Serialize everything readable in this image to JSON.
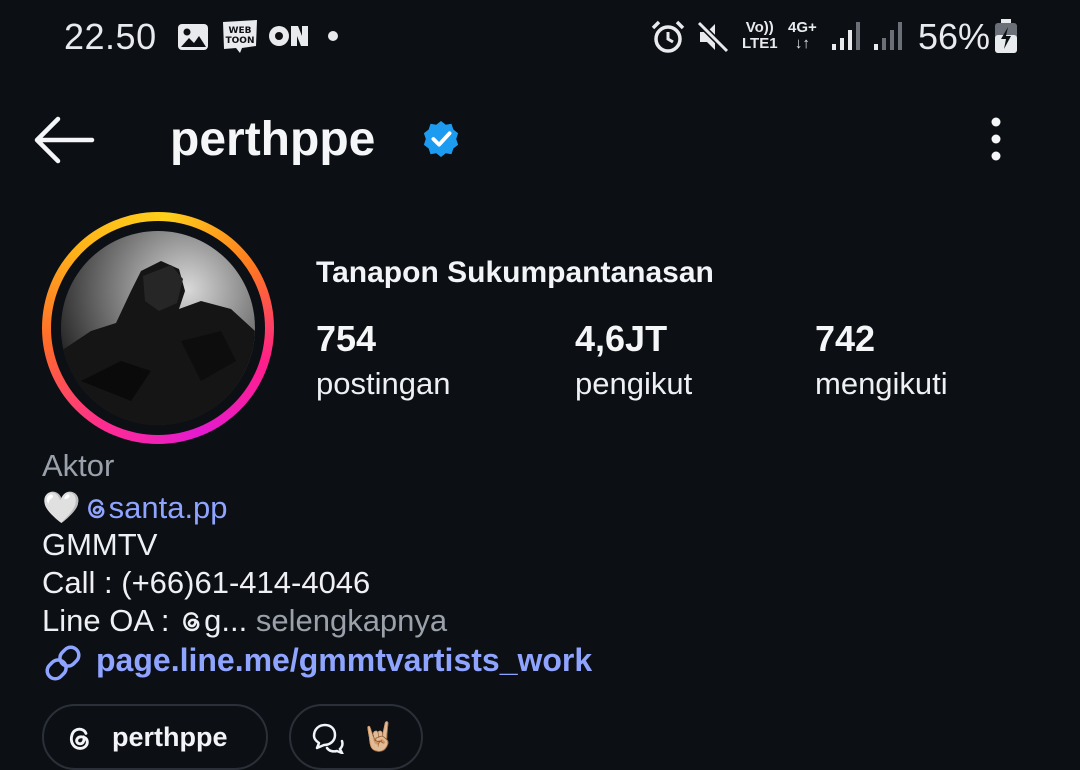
{
  "status_bar": {
    "time": "22.50",
    "lte_top": "Vo))",
    "lte_bottom": "LTE1",
    "net_top": "4G+",
    "net_bottom": "↓↑",
    "battery": "56%"
  },
  "header": {
    "username": "perthppe",
    "icons": [
      "back-arrow-icon",
      "verified-badge-icon",
      "more-vertical-icon"
    ],
    "verified_color": "#1d9bf0"
  },
  "profile": {
    "full_name": "Tanapon Sukumpantanasan",
    "stats": [
      {
        "value": "754",
        "label": "postingan"
      },
      {
        "value": "4,6JT",
        "label": "pengikut"
      },
      {
        "value": "742",
        "label": "mengikuti"
      }
    ]
  },
  "bio": {
    "category": "Aktor",
    "heart": "🤍",
    "mention_prefix": "@",
    "mention": "santa.pp",
    "line2": "GMMTV",
    "line3": "Call : (+66)61-414-4046",
    "line4_start": "Line OA : ",
    "line4_trunc": "g... ",
    "more": "selengkapnya",
    "link": "page.line.me/gmmtvartists_work"
  },
  "chips": {
    "threads_label": "perthppe",
    "emoji": "🤘🏼"
  },
  "colors": {
    "background": "#0c0f14",
    "link": "#8fa4ff",
    "muted": "#9aa1ab"
  }
}
